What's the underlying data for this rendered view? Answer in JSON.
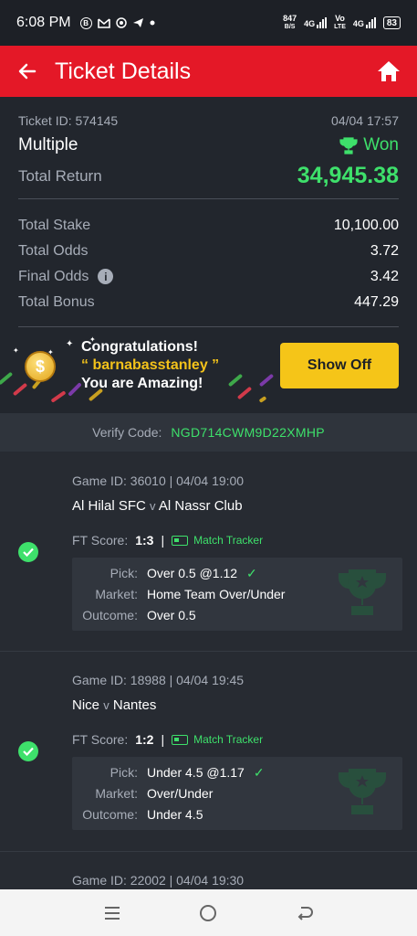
{
  "status_bar": {
    "time": "6:08 PM",
    "net_speed_value": "847",
    "net_speed_unit": "B/S",
    "net1": "4G",
    "volte_top": "Vo",
    "volte_bottom": "LTE",
    "net2": "4G",
    "battery": "83"
  },
  "header": {
    "title": "Ticket Details"
  },
  "ticket": {
    "id_label": "Ticket ID: 574145",
    "date": "04/04 17:57",
    "type": "Multiple",
    "status": "Won",
    "return_label": "Total Return",
    "return_value": "34,945.38",
    "rows": [
      {
        "label": "Total Stake",
        "value": "10,100.00"
      },
      {
        "label": "Total Odds",
        "value": "3.72"
      },
      {
        "label": "Final Odds",
        "value": "3.42"
      },
      {
        "label": "Total Bonus",
        "value": "447.29"
      }
    ]
  },
  "banner": {
    "line1": "Congratulations!",
    "username": "“ barnabasstanley ”",
    "line3": "You are Amazing!",
    "button": "Show Off"
  },
  "verify": {
    "label": "Verify Code:",
    "code": "NGD714CWM9D22XMHP"
  },
  "games": [
    {
      "header": "Game ID: 36010 | 04/04 19:00",
      "home": "Al Hilal SFC",
      "away": "Al Nassr Club",
      "vs": "v",
      "score_label": "FT Score:",
      "score": "1:3",
      "tracker": "Match Tracker",
      "pick_label": "Pick:",
      "pick": "Over 0.5 @1.12",
      "market_label": "Market:",
      "market": "Home Team Over/Under",
      "outcome_label": "Outcome:",
      "outcome": "Over 0.5"
    },
    {
      "header": "Game ID: 18988 | 04/04 19:45",
      "home": "Nice",
      "away": "Nantes",
      "vs": "v",
      "score_label": "FT Score:",
      "score": "1:2",
      "tracker": "Match Tracker",
      "pick_label": "Pick:",
      "pick": "Under 4.5 @1.17",
      "market_label": "Market:",
      "market": "Over/Under",
      "outcome_label": "Outcome:",
      "outcome": "Under 4.5"
    },
    {
      "header": "Game ID: 22002 | 04/04 19:30"
    }
  ],
  "colors": {
    "accent_red": "#e41827",
    "win_green": "#3ee06b",
    "button_yellow": "#f5c518"
  }
}
